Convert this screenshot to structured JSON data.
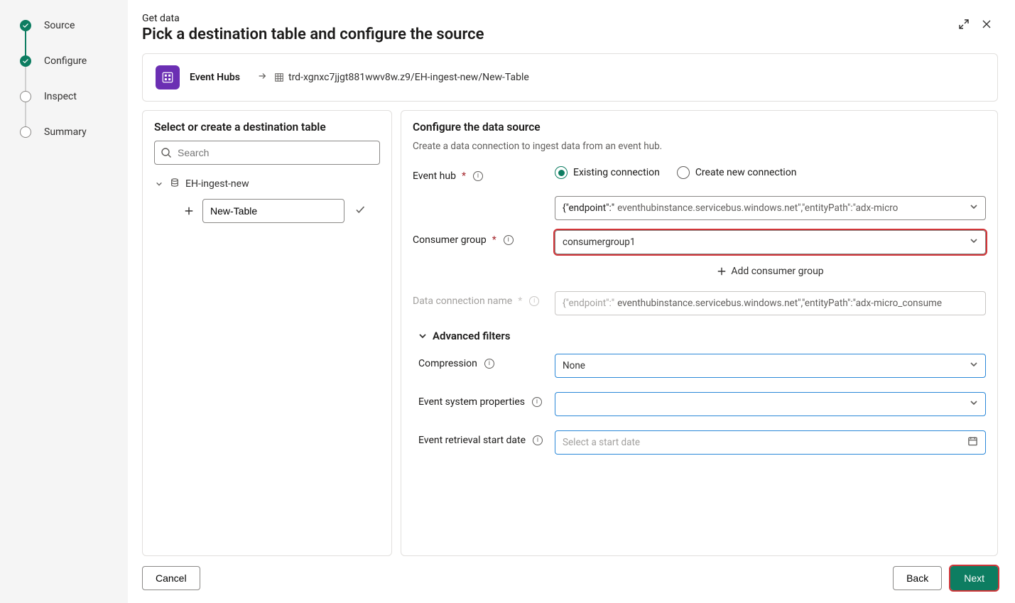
{
  "sidebar": {
    "steps": [
      {
        "label": "Source",
        "state": "done"
      },
      {
        "label": "Configure",
        "state": "done"
      },
      {
        "label": "Inspect",
        "state": "pending"
      },
      {
        "label": "Summary",
        "state": "pending"
      }
    ]
  },
  "header": {
    "kicker": "Get data",
    "title": "Pick a destination table and configure the source"
  },
  "breadcrumb": {
    "source_name": "Event Hubs",
    "path_text": "trd-xgnxc7jjgt881wwv8w.z9/EH-ingest-new/New-Table"
  },
  "left_pane": {
    "title": "Select or create a destination table",
    "search_placeholder": "Search",
    "database_name": "EH-ingest-new",
    "table_name": "New-Table"
  },
  "right_pane": {
    "title": "Configure the data source",
    "subtitle": "Create a data connection to ingest data from an event hub.",
    "event_hub_label": "Event hub",
    "radio_existing": "Existing connection",
    "radio_createnew": "Create new connection",
    "endpoint_prefix": "{\"endpoint\":\"",
    "endpoint_rest": "eventhubinstance.servicebus.windows.net\",\"entityPath\":\"adx-micro",
    "consumer_group_label": "Consumer group",
    "consumer_group_value": "consumergroup1",
    "add_consumer_group": "Add consumer group",
    "dcname_label": "Data connection name",
    "dcname_prefix": "{\"endpoint\":\"",
    "dcname_rest": "eventhubinstance.servicebus.windows.net\",\"entityPath\":\"adx-micro_consume",
    "advanced_label": "Advanced filters",
    "compression_label": "Compression",
    "compression_value": "None",
    "sysprops_label": "Event system properties",
    "startdate_label": "Event retrieval start date",
    "startdate_placeholder": "Select a start date"
  },
  "footer": {
    "cancel": "Cancel",
    "back": "Back",
    "next": "Next"
  }
}
